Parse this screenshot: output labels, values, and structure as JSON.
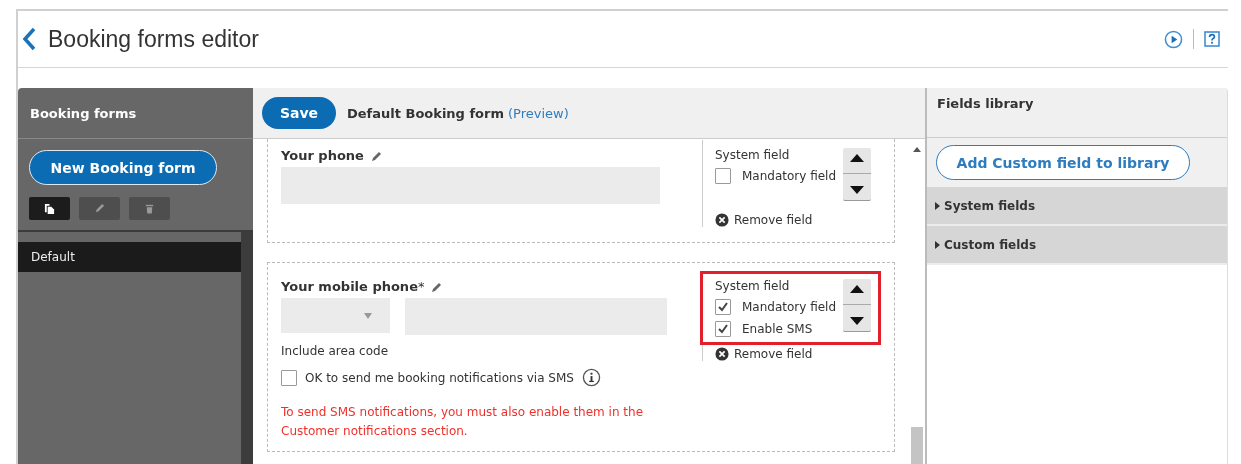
{
  "page": {
    "title": "Booking forms editor"
  },
  "sidebar": {
    "title": "Booking forms",
    "new_button": "New Booking form",
    "tools": [
      {
        "kind": "copy",
        "selected": true
      },
      {
        "kind": "edit",
        "selected": false
      },
      {
        "kind": "delete",
        "selected": false
      }
    ],
    "items": [
      {
        "label": "Default",
        "selected": true
      }
    ]
  },
  "editor": {
    "save": "Save",
    "form_name": "Default Booking form",
    "preview_link": "(Preview)",
    "fields": [
      {
        "kind": "single",
        "label": "Your phone",
        "system_label": "System field",
        "options": [
          {
            "label": "Mandatory field",
            "checked": false
          }
        ],
        "remove": "Remove field",
        "highlighted": false
      },
      {
        "kind": "mobile",
        "label": "Your mobile phone",
        "required_mark": "*",
        "hint": "Include area code",
        "consent": {
          "label": "OK to send me booking notifications via SMS",
          "checked": false
        },
        "note": "To send SMS notifications, you must also enable them in the Customer notifications section.",
        "system_label": "System field",
        "options": [
          {
            "label": "Mandatory field",
            "checked": true
          },
          {
            "label": "Enable SMS",
            "checked": true
          }
        ],
        "remove": "Remove field",
        "highlighted": true
      }
    ]
  },
  "library": {
    "title": "Fields library",
    "add_button": "Add Custom field to library",
    "groups": [
      {
        "label": "System fields",
        "expanded": false
      },
      {
        "label": "Custom fields",
        "expanded": false
      }
    ]
  }
}
